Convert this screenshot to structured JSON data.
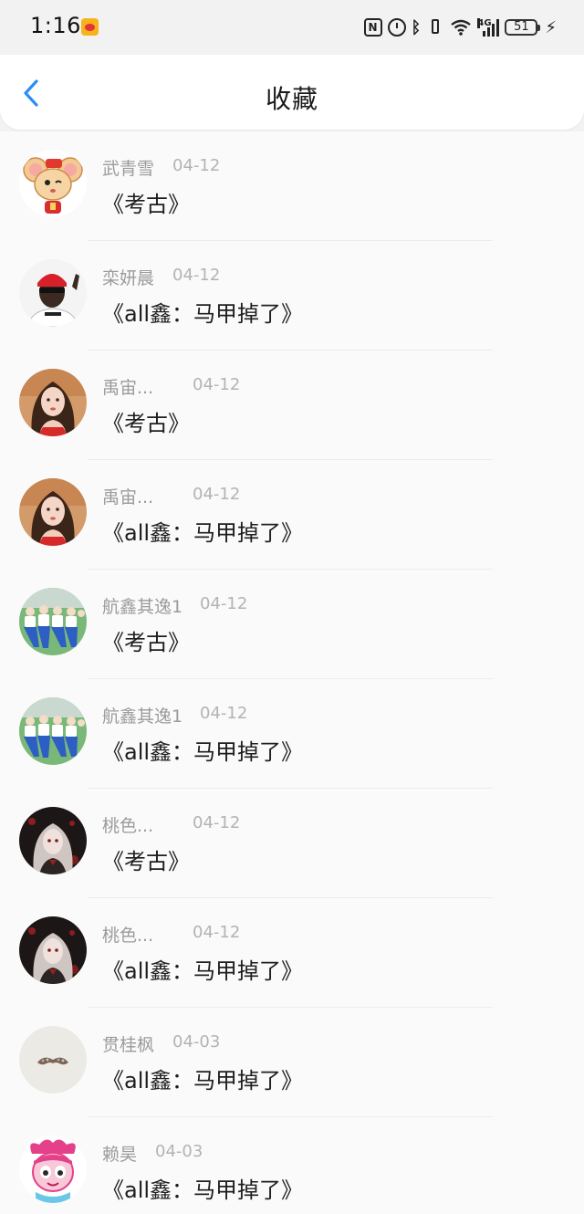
{
  "status_bar": {
    "time": "1:16",
    "network": "4G",
    "battery": "51"
  },
  "header": {
    "title": "收藏"
  },
  "favorites": [
    {
      "user": "武青雪",
      "date": "04-12",
      "title": "《考古》",
      "avatar": "cartoon-mouse-avatar"
    },
    {
      "user": "栾妍晨",
      "date": "04-12",
      "title": "《all鑫：马甲掉了》",
      "avatar": "man-red-beanie-avatar"
    },
    {
      "user": "禹宙...",
      "date": "04-12",
      "title": "《考古》",
      "avatar": "woman-portrait-avatar"
    },
    {
      "user": "禹宙...",
      "date": "04-12",
      "title": "《all鑫：马甲掉了》",
      "avatar": "woman-portrait-avatar"
    },
    {
      "user": "航鑫其逸1",
      "date": "04-12",
      "title": "《考古》",
      "avatar": "group-photo-avatar"
    },
    {
      "user": "航鑫其逸1",
      "date": "04-12",
      "title": "《all鑫：马甲掉了》",
      "avatar": "group-photo-avatar"
    },
    {
      "user": "桃色...",
      "date": "04-12",
      "title": "《考古》",
      "avatar": "dark-anime-avatar"
    },
    {
      "user": "桃色...",
      "date": "04-12",
      "title": "《all鑫：马甲掉了》",
      "avatar": "dark-anime-avatar"
    },
    {
      "user": "贯桂枫",
      "date": "04-03",
      "title": "《all鑫：马甲掉了》",
      "avatar": "mustache-avatar"
    },
    {
      "user": "赖昊",
      "date": "04-03",
      "title": "《all鑫：马甲掉了》",
      "avatar": "pink-cartoon-avatar"
    }
  ]
}
